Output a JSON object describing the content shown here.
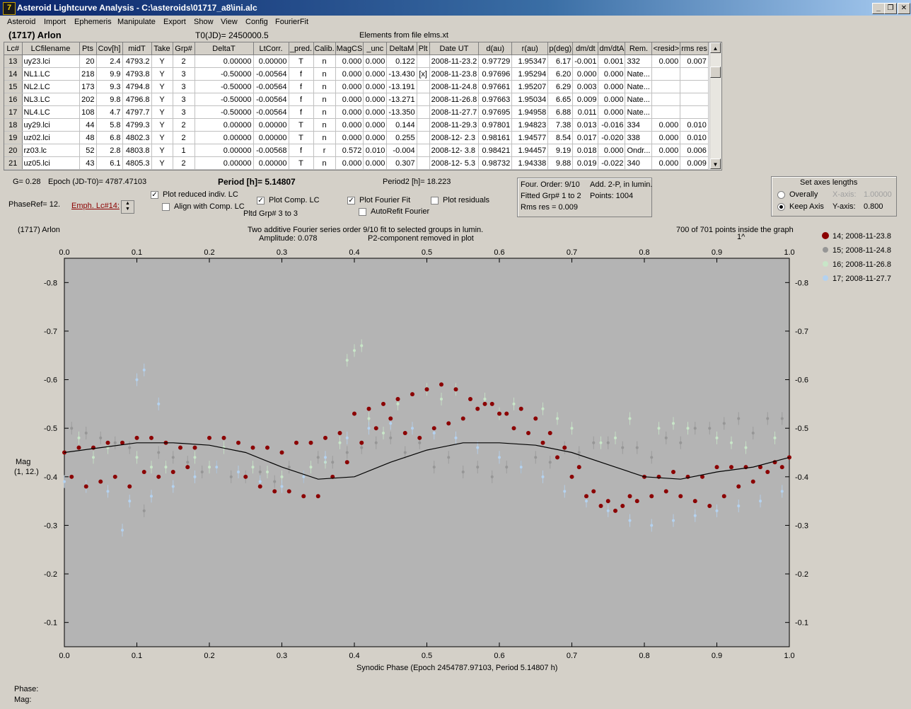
{
  "window": {
    "title": "Asteroid Lightcurve Analysis - C:\\asteroids\\01717_a8\\ini.alc",
    "icon_label": "7",
    "buttons": [
      "_",
      "❐",
      "✕"
    ]
  },
  "menu": [
    "Asteroid",
    "Import",
    "Ephemeris",
    "Manipulate",
    "Export",
    "Show",
    "View",
    "Config",
    "FourierFit"
  ],
  "header": {
    "asteroid": "(1717) Arlon",
    "t0": "T0(JD)= 2450000.5",
    "elements_note": "Elements from file elms.xt"
  },
  "table": {
    "columns": [
      "Lc#",
      "LCfilename",
      "Pts",
      "Cov[h]",
      "midT",
      "Take",
      "Grp#",
      "DeltaT",
      "LtCorr.",
      "_pred.",
      "Calib.",
      "MagCS",
      "_unc",
      "DeltaM",
      "Plt",
      "Date UT",
      "d(au)",
      "r(au)",
      "p(deg)",
      "dm/dt",
      "dm/dtA",
      "Rem.",
      "<resid>",
      "rms res"
    ],
    "rows": [
      [
        "13",
        "uy23.lci",
        "20",
        "2.4",
        "4793.2",
        "Y",
        "2",
        "0.00000",
        "0.00000",
        "T",
        "n",
        "0.000",
        "0.000",
        "0.122",
        "",
        "2008-11-23.2",
        "0.97729",
        "1.95347",
        "6.17",
        "-0.001",
        "0.001",
        "332",
        "0.000",
        "0.007"
      ],
      [
        "14",
        "NL1.LC",
        "218",
        "9.9",
        "4793.8",
        "Y",
        "3",
        "-0.50000",
        "-0.00564",
        "f",
        "n",
        "0.000",
        "0.000",
        "-13.430",
        "[x]",
        "2008-11-23.8",
        "0.97696",
        "1.95294",
        "6.20",
        "0.000",
        "0.000",
        "Nate...",
        "",
        ""
      ],
      [
        "15",
        "NL2.LC",
        "173",
        "9.3",
        "4794.8",
        "Y",
        "3",
        "-0.50000",
        "-0.00564",
        "f",
        "n",
        "0.000",
        "0.000",
        "-13.191",
        "",
        "2008-11-24.8",
        "0.97661",
        "1.95207",
        "6.29",
        "0.003",
        "0.000",
        "Nate...",
        "",
        ""
      ],
      [
        "16",
        "NL3.LC",
        "202",
        "9.8",
        "4796.8",
        "Y",
        "3",
        "-0.50000",
        "-0.00564",
        "f",
        "n",
        "0.000",
        "0.000",
        "-13.271",
        "",
        "2008-11-26.8",
        "0.97663",
        "1.95034",
        "6.65",
        "0.009",
        "0.000",
        "Nate...",
        "",
        ""
      ],
      [
        "17",
        "NL4.LC",
        "108",
        "4.7",
        "4797.7",
        "Y",
        "3",
        "-0.50000",
        "-0.00564",
        "f",
        "n",
        "0.000",
        "0.000",
        "-13.350",
        "",
        "2008-11-27.7",
        "0.97695",
        "1.94958",
        "6.88",
        "0.011",
        "0.000",
        "Nate...",
        "",
        ""
      ],
      [
        "18",
        "uy29.lci",
        "44",
        "5.8",
        "4799.3",
        "Y",
        "2",
        "0.00000",
        "0.00000",
        "T",
        "n",
        "0.000",
        "0.000",
        "0.144",
        "",
        "2008-11-29.3",
        "0.97801",
        "1.94823",
        "7.38",
        "0.013",
        "-0.016",
        "334",
        "0.000",
        "0.010"
      ],
      [
        "19",
        "uz02.lci",
        "48",
        "6.8",
        "4802.3",
        "Y",
        "2",
        "0.00000",
        "0.00000",
        "T",
        "n",
        "0.000",
        "0.000",
        "0.255",
        "",
        "2008-12- 2.3",
        "0.98161",
        "1.94577",
        "8.54",
        "0.017",
        "-0.020",
        "338",
        "0.000",
        "0.010"
      ],
      [
        "20",
        "rz03.lc",
        "52",
        "2.8",
        "4803.8",
        "Y",
        "1",
        "0.00000",
        "-0.00568",
        "f",
        "r",
        "0.572",
        "0.010",
        "-0.004",
        "",
        "2008-12- 3.8",
        "0.98421",
        "1.94457",
        "9.19",
        "0.018",
        "0.000",
        "Ondr...",
        "0.000",
        "0.006"
      ],
      [
        "21",
        "uz05.lci",
        "43",
        "6.1",
        "4805.3",
        "Y",
        "2",
        "0.00000",
        "0.00000",
        "T",
        "n",
        "0.000",
        "0.000",
        "0.307",
        "",
        "2008-12- 5.3",
        "0.98732",
        "1.94338",
        "9.88",
        "0.019",
        "-0.022",
        "340",
        "0.000",
        "0.009"
      ]
    ]
  },
  "controls": {
    "g": "G= 0.28",
    "epoch": "Epoch (JD-T0)= 4787.47103",
    "period": "Period [h]= 5.14807",
    "period2": "Period2 [h]= 18.223",
    "phaseref": "PhaseRef= 12.",
    "emph_link": "Emph. Lc#14:",
    "plot_reduced": "Plot reduced indiv. LC",
    "align_comp": "Align with Comp. LC",
    "plot_comp": "Plot Comp. LC",
    "pltd_grp": "Pltd Grp#  3  to   3",
    "plot_fourier": "Plot Fourier Fit",
    "autorefit": "AutoRefit Fourier",
    "plot_residuals": "Plot residuals",
    "checks": {
      "plot_reduced": true,
      "align_comp": false,
      "plot_comp": true,
      "plot_fourier": true,
      "autorefit": false,
      "plot_residuals": false
    }
  },
  "fourier_info": {
    "order": "Four. Order:  9/10",
    "add": "Add. 2-P, in lumin.",
    "fitted": "Fitted Grp# 1 to 2",
    "points": "Points: 1004",
    "rms": "Rms res     = 0.009"
  },
  "axes_box": {
    "title": "Set axes lengths",
    "overally": "Overally",
    "keep_axis": "Keep Axis",
    "x_label": "X-axis:",
    "x_value": "1.00000",
    "y_label": "Y-axis:",
    "y_value": "0.800",
    "selected": "keep_axis"
  },
  "plot": {
    "asteroid": "(1717) Arlon",
    "title_line1": "Two additive Fourier series order 9/10 fit to selected groups in lumin.",
    "title_line2_left": "Amplitude: 0.078",
    "title_line2_right": "P2-component removed in plot",
    "points_inside": "700 of 701 points inside the graph",
    "points_marker": "1^",
    "ylabel_line1": "Mag",
    "ylabel_line2": "(1, 12.)",
    "xlabel": "Synodic Phase (Epoch 2454787.97103, Period 5.14807 h)",
    "background": "#b4b4b4",
    "curve_color": "#000000"
  },
  "chart_data": {
    "type": "scatter",
    "x_range": [
      0.0,
      1.0
    ],
    "y_range": [
      -0.85,
      -0.05
    ],
    "x_ticks": [
      "0.0",
      "0.1",
      "0.2",
      "0.3",
      "0.4",
      "0.5",
      "0.6",
      "0.7",
      "0.8",
      "0.9",
      "1.0"
    ],
    "y_ticks": [
      "-0.8",
      "-0.7",
      "-0.6",
      "-0.5",
      "-0.4",
      "-0.3",
      "-0.2",
      "-0.1"
    ],
    "y_inverted": true,
    "legend_position": "right",
    "series": [
      {
        "name": "14; 2008-11-23.8",
        "color": "#8b0000",
        "size": 6,
        "x": [
          0.0,
          0.02,
          0.04,
          0.06,
          0.08,
          0.1,
          0.12,
          0.14,
          0.16,
          0.18,
          0.2,
          0.22,
          0.24,
          0.26,
          0.28,
          0.3,
          0.32,
          0.34,
          0.36,
          0.38,
          0.4,
          0.42,
          0.44,
          0.46,
          0.48,
          0.5,
          0.52,
          0.54,
          0.56,
          0.58,
          0.6,
          0.62,
          0.64,
          0.66,
          0.68,
          0.7,
          0.72,
          0.74,
          0.76,
          0.78,
          0.8,
          0.82,
          0.84,
          0.86,
          0.88,
          0.9,
          0.92,
          0.94,
          0.96,
          0.98,
          1.0,
          0.01,
          0.03,
          0.05,
          0.07,
          0.09,
          0.11,
          0.13,
          0.15,
          0.17,
          0.25,
          0.27,
          0.29,
          0.31,
          0.33,
          0.35,
          0.37,
          0.39,
          0.41,
          0.43,
          0.45,
          0.47,
          0.49,
          0.51,
          0.53,
          0.55,
          0.57,
          0.59,
          0.61,
          0.63,
          0.65,
          0.67,
          0.69,
          0.71,
          0.73,
          0.75,
          0.77,
          0.79,
          0.81,
          0.83,
          0.85,
          0.87,
          0.89,
          0.91,
          0.93,
          0.95,
          0.97,
          0.99
        ],
        "y": [
          -0.45,
          -0.46,
          -0.46,
          -0.47,
          -0.47,
          -0.48,
          -0.48,
          -0.47,
          -0.46,
          -0.46,
          -0.48,
          -0.48,
          -0.47,
          -0.46,
          -0.46,
          -0.45,
          -0.47,
          -0.47,
          -0.48,
          -0.49,
          -0.53,
          -0.54,
          -0.55,
          -0.56,
          -0.57,
          -0.58,
          -0.59,
          -0.58,
          -0.56,
          -0.55,
          -0.53,
          -0.5,
          -0.49,
          -0.47,
          -0.44,
          -0.4,
          -0.36,
          -0.34,
          -0.33,
          -0.36,
          -0.4,
          -0.4,
          -0.41,
          -0.4,
          -0.4,
          -0.42,
          -0.42,
          -0.42,
          -0.42,
          -0.43,
          -0.44,
          -0.4,
          -0.38,
          -0.39,
          -0.4,
          -0.38,
          -0.41,
          -0.4,
          -0.41,
          -0.42,
          -0.4,
          -0.38,
          -0.37,
          -0.37,
          -0.36,
          -0.36,
          -0.4,
          -0.43,
          -0.47,
          -0.5,
          -0.52,
          -0.49,
          -0.48,
          -0.5,
          -0.51,
          -0.52,
          -0.54,
          -0.55,
          -0.53,
          -0.54,
          -0.52,
          -0.49,
          -0.46,
          -0.42,
          -0.37,
          -0.35,
          -0.34,
          -0.35,
          -0.36,
          -0.37,
          -0.36,
          -0.35,
          -0.34,
          -0.36,
          -0.38,
          -0.39,
          -0.41,
          -0.42
        ]
      },
      {
        "name": "15; 2008-11-24.8",
        "color": "#969696",
        "size": 3,
        "x": [
          0.01,
          0.05,
          0.09,
          0.13,
          0.17,
          0.21,
          0.25,
          0.29,
          0.33,
          0.37,
          0.41,
          0.45,
          0.49,
          0.53,
          0.57,
          0.61,
          0.65,
          0.69,
          0.73,
          0.77,
          0.81,
          0.85,
          0.89,
          0.93,
          0.97,
          0.03,
          0.07,
          0.11,
          0.15,
          0.19,
          0.23,
          0.27,
          0.31,
          0.35,
          0.39,
          0.43,
          0.47,
          0.51,
          0.55,
          0.59,
          0.63,
          0.67,
          0.71,
          0.75,
          0.79,
          0.83,
          0.87,
          0.91,
          0.95,
          0.99
        ],
        "y": [
          -0.5,
          -0.48,
          -0.46,
          -0.45,
          -0.43,
          -0.42,
          -0.4,
          -0.39,
          -0.4,
          -0.43,
          -0.46,
          -0.48,
          -0.47,
          -0.44,
          -0.42,
          -0.42,
          -0.44,
          -0.46,
          -0.47,
          -0.46,
          -0.44,
          -0.47,
          -0.5,
          -0.52,
          -0.52,
          -0.49,
          -0.47,
          -0.33,
          -0.44,
          -0.41,
          -0.4,
          -0.41,
          -0.42,
          -0.44,
          -0.45,
          -0.47,
          -0.45,
          -0.42,
          -0.41,
          -0.4,
          -0.42,
          -0.43,
          -0.45,
          -0.47,
          -0.46,
          -0.48,
          -0.5,
          -0.51,
          -0.49,
          -0.52
        ]
      },
      {
        "name": "16; 2008-11-26.8",
        "color": "#c8e6c8",
        "size": 3,
        "x": [
          0.02,
          0.06,
          0.1,
          0.14,
          0.18,
          0.22,
          0.26,
          0.3,
          0.34,
          0.38,
          0.42,
          0.46,
          0.5,
          0.54,
          0.58,
          0.62,
          0.66,
          0.7,
          0.74,
          0.78,
          0.82,
          0.86,
          0.9,
          0.94,
          0.98,
          0.39,
          0.4,
          0.41,
          0.04,
          0.12,
          0.2,
          0.28,
          0.36,
          0.44,
          0.52,
          0.6,
          0.68,
          0.76,
          0.84,
          0.92
        ],
        "y": [
          -0.48,
          -0.46,
          -0.44,
          -0.42,
          -0.44,
          -0.46,
          -0.42,
          -0.4,
          -0.42,
          -0.47,
          -0.52,
          -0.55,
          -0.58,
          -0.58,
          -0.56,
          -0.55,
          -0.54,
          -0.5,
          -0.47,
          -0.52,
          -0.5,
          -0.5,
          -0.48,
          -0.46,
          -0.48,
          -0.64,
          -0.66,
          -0.67,
          -0.44,
          -0.42,
          -0.42,
          -0.41,
          -0.43,
          -0.49,
          -0.56,
          -0.53,
          -0.52,
          -0.48,
          -0.51,
          -0.47
        ]
      },
      {
        "name": "17; 2008-11-27.7",
        "color": "#b4d2f0",
        "size": 3,
        "x": [
          0.0,
          0.03,
          0.06,
          0.09,
          0.12,
          0.15,
          0.18,
          0.21,
          0.24,
          0.27,
          0.3,
          0.33,
          0.36,
          0.39,
          0.42,
          0.45,
          0.48,
          0.51,
          0.54,
          0.57,
          0.6,
          0.63,
          0.66,
          0.69,
          0.72,
          0.75,
          0.78,
          0.81,
          0.84,
          0.87,
          0.9,
          0.93,
          0.96,
          0.99,
          0.1,
          0.11,
          0.08,
          0.13
        ],
        "y": [
          -0.39,
          -0.38,
          -0.37,
          -0.35,
          -0.36,
          -0.38,
          -0.4,
          -0.42,
          -0.41,
          -0.39,
          -0.38,
          -0.4,
          -0.44,
          -0.48,
          -0.5,
          -0.51,
          -0.5,
          -0.49,
          -0.48,
          -0.46,
          -0.44,
          -0.42,
          -0.4,
          -0.37,
          -0.35,
          -0.33,
          -0.31,
          -0.3,
          -0.31,
          -0.32,
          -0.33,
          -0.34,
          -0.35,
          -0.37,
          -0.6,
          -0.62,
          -0.29,
          -0.55
        ]
      }
    ],
    "fit_curve": {
      "x": [
        0.0,
        0.05,
        0.1,
        0.15,
        0.2,
        0.25,
        0.3,
        0.35,
        0.4,
        0.45,
        0.5,
        0.55,
        0.6,
        0.65,
        0.7,
        0.75,
        0.8,
        0.85,
        0.9,
        0.95,
        1.0
      ],
      "y": [
        -0.45,
        -0.46,
        -0.47,
        -0.47,
        -0.465,
        -0.45,
        -0.42,
        -0.395,
        -0.4,
        -0.43,
        -0.455,
        -0.47,
        -0.47,
        -0.465,
        -0.45,
        -0.425,
        -0.4,
        -0.395,
        -0.41,
        -0.42,
        -0.44
      ]
    }
  },
  "status": {
    "phase": "Phase:",
    "mag": "Mag:"
  }
}
